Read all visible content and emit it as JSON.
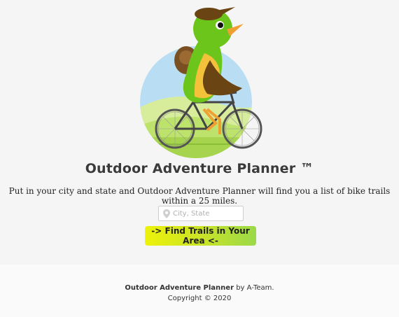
{
  "hero": {
    "illustration": "bird-riding-bicycle-icon"
  },
  "header": {
    "title": "Outdoor Adventure Planner ™",
    "description": "Put in your city and state and Outdoor Adventure Planner will find you a list of bike trails within a 25 miles."
  },
  "search": {
    "placeholder": "City, State",
    "value": "",
    "icon": "location-pin-icon"
  },
  "cta": {
    "label": "-> Find Trails in Your Area <-"
  },
  "footer": {
    "brand": "Outdoor Adventure Planner",
    "by_text": " by A-Team.",
    "copyright": "Copyright © 2020"
  },
  "colors": {
    "background": "#f5f5f5",
    "button_start": "#eef20a",
    "button_end": "#9ad94a",
    "bird_green": "#6cc51a",
    "bird_brown": "#6b4414",
    "sky_blue": "#b9def3"
  }
}
